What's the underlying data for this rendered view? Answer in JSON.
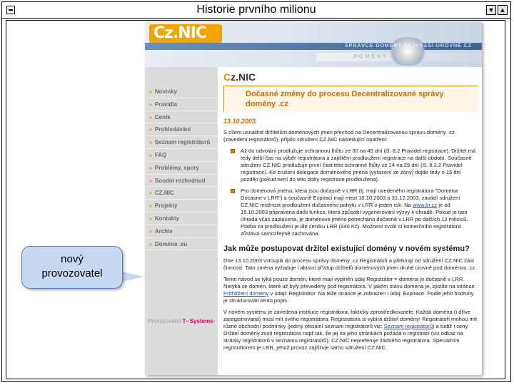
{
  "window": {
    "title": "Historie prvního milionu",
    "menu_label": "▼",
    "max_label": "▲"
  },
  "site": {
    "logo": "Cz.NIC",
    "tagline": "SPRÁVCE DOMÉNY NEJVYŠŠÍ ÚROVNĚ CZ",
    "banner_word": "DOMÉNY",
    "nav": [
      "Novinky",
      "Pravidla",
      "Ceník",
      "Prohledávání",
      "Seznam registrátorů",
      "FAQ",
      "Problémy, spory",
      "Soudní rozhodnutí",
      "CZ.NIC",
      "Projekty",
      "Kontakty",
      "Archiv",
      "Doména .eu"
    ],
    "operator_prefix": "Provozovatel",
    "operator_brand": "T··Systems·",
    "page_title_c": "C",
    "page_title_rest": "z.NIC",
    "headline": "Dočasné změny do procesu Decentralizované správy domény .cz",
    "date": "13.10.2003",
    "intro": "S cílem usnadnit držitelům doménových jmen přechod na Decentralizovanou správu domény .cz (zavedení registrátorů), přijalo sdružení CZ.NIC následující opatření:",
    "bullet1": "Až do odvolání prodlužuje ochrannou lhůtu ze 30 na 45 dní (čl. 8.2 Pravidel registrace). Držitel má tedy delší čas na výběr registrátora a zajištění prodloužení registrace na další období. Současně sdružení CZ.NIC prodlužuje první část této ochranné lhůty ze 14 na 29 dní (čl. 8.2.2 Pravidel registrace). Ke zrušení delegace doménového jména (vyřazení ze zóny) dojde tedy o 15 dní později (pokud není do této doby registrace prodloužena).",
    "bullet2_a": "Pro doménová jména, která jsou dočasně v LRR (tj. mají uvedeného registrátora \"Domena Docasne v LRR\") a současně Expiraci mají mezi 10.10.2003 a 31.12.2003, zavádí sdružení CZ.NIC možnost prodloužení dočasného pobytu v LRR o jeden rok. Na ",
    "bullet2_link": "www.lrr.cz",
    "bullet2_b": " je od 15.10.2003 připravena další funkce, která způsobí vygenerování výzvy k úhradě. Pokud je tato úhrada včas zaplacena, je doménové jméno ponecháno dočasně v LRR po dalších 12 měsíců. Platba za prodloužení je dle ceníku LRR (840 Kč). Možnost zvolit si komerčního registrátora zůstává samozřejmě zachována.",
    "question": "Jak může postupovat držitel existující domény v novém systému?",
    "para1": "Dne 13.10.2003 vstoupili do procesu správy domény .cz Registrátoři a přebírají od sdružení CZ.NIC část činností. Tato změna vyžaduje i aktivní přístup držitelů doménových jmen druhé úrovně pod doménou .cz.",
    "para2_a": "Tento návod se týká pouze domén, které mají vyplněn údaj Registrátor = doména je dočasně v LRR. Netýká se domén, které už byly převedeny pod registrátora. V jakém stavu doména je, zjistíte na stránce: ",
    "para2_link": "Prohlížení domény",
    "para2_b": " v údaji: Registrátor. Na téže stránce je zobrazen i údaj: Expirace. Podle jeho hodnoty je strukturován tento popis.",
    "para3_a": "V novém systému je zavedena instituce registrátora, fakticky zprostředkovatele. Každá doména (i dříve zaregistrovaná) musí mít svého registrátora. Registrátora si vybírá držitel domény! Registrátoři mohou mít různé obchodní podmínky (jediný oficiální seznam registrátorů viz: ",
    "para3_link": "Seznam registrátorů",
    "para3_b": ") a tudíž i ceny. Držitel domény zvolí registrátora např.tak, že jej na jeho stránkách požádá o registraci (viz odkaz na stránky registrátorů v seznamu registrátorů). CZ.NIC nepreferuje žádného registrátora. Speciálním registrátorem je LRR, jehož provoz zajišťuje samo sdružení CZ.NIC."
  },
  "callout": {
    "line1": "nový",
    "line2": "provozovatel"
  },
  "colors": {
    "accent": "#e08a00",
    "callout_fill": "#c6d9f1"
  }
}
